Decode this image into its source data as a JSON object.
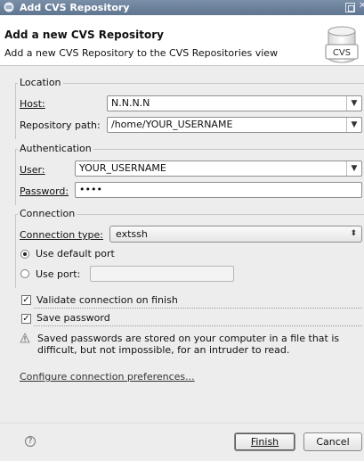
{
  "window": {
    "title": "Add CVS Repository"
  },
  "header": {
    "title": "Add a new CVS Repository",
    "description": "Add a new CVS Repository to the CVS Repositories view",
    "icon_text": "CVS"
  },
  "location": {
    "group_label": "Location",
    "host_label": "Host:",
    "host_value": "N.N.N.N",
    "path_label": "Repository path:",
    "path_value": "/home/YOUR_USERNAME"
  },
  "authentication": {
    "group_label": "Authentication",
    "user_label": "User:",
    "user_value": "YOUR_USERNAME",
    "password_label": "Password:",
    "password_value": "••••"
  },
  "connection": {
    "group_label": "Connection",
    "type_label": "Connection type:",
    "type_value": "extssh",
    "default_port_label": "Use default port",
    "use_port_label": "Use port:",
    "port_value": "",
    "default_port_selected": true
  },
  "options": {
    "validate_label": "Validate connection on finish",
    "validate_checked": true,
    "save_password_label": "Save password",
    "save_password_checked": true
  },
  "warning": {
    "text": "Saved passwords are stored on your computer in a file that is difficult, but not impossible, for an intruder to read."
  },
  "link": {
    "label": "Configure connection preferences..."
  },
  "footer": {
    "finish_label": "Finish",
    "cancel_label": "Cancel"
  },
  "icons": [
    "app-icon",
    "maximize-icon",
    "cvs-repository-icon",
    "chevron-down-icon",
    "up-down-icon",
    "warning-icon",
    "help-icon"
  ],
  "colors": {
    "titlebar": "#6a7f99",
    "header_bg": "#ffffff",
    "window_bg": "#ededed"
  }
}
